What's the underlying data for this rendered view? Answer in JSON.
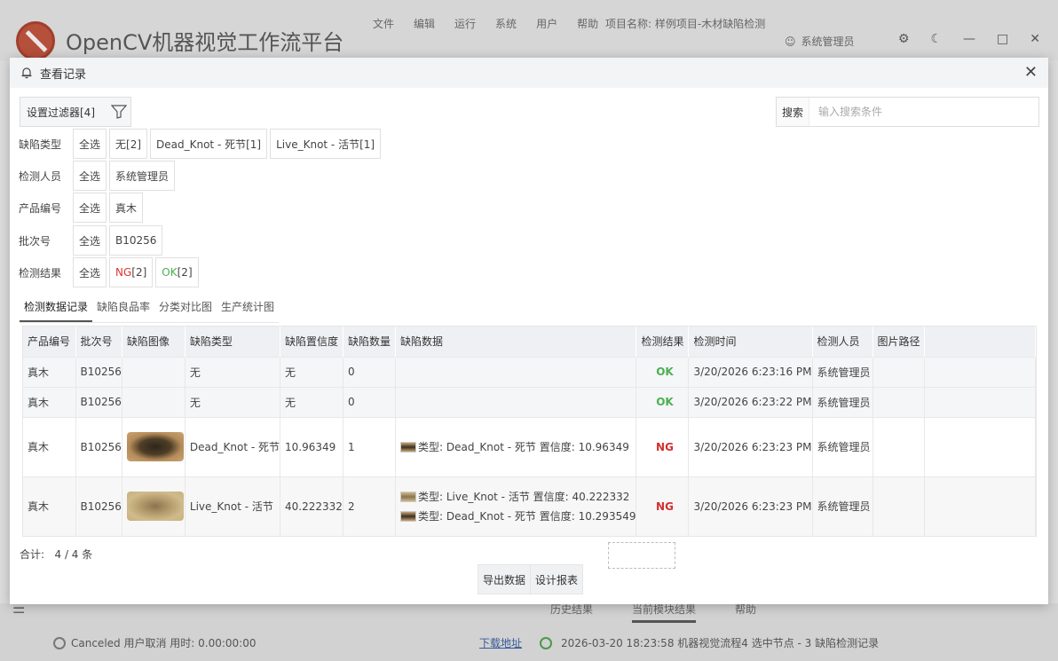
{
  "app": {
    "title": "OpenCV机器视觉工作流平台",
    "menu": [
      "文件",
      "编辑",
      "运行",
      "系统",
      "用户",
      "帮助"
    ],
    "project": "项目名称:  样例项目-木材缺陷检测",
    "user": "系统管理员",
    "bottom_tabs": [
      "历史结果",
      "当前模块结果",
      "帮助"
    ],
    "status_left": "Canceled 用户取消 用时: 0.00:00:00",
    "status_link": "下载地址",
    "status_right": "2026-03-20 18:23:58  机器视觉流程4 选中节点 - 3 缺陷检测记录"
  },
  "modal": {
    "title": "查看记录",
    "filter_button": "设置过滤器[4]",
    "search_label": "搜索",
    "search_placeholder": "输入搜索条件",
    "filters": [
      {
        "label": "缺陷类型",
        "chips": [
          "全选",
          "无[2]",
          "Dead_Knot - 死节[1]",
          "Live_Knot - 活节[1]"
        ]
      },
      {
        "label": "检测人员",
        "chips": [
          "全选",
          "系统管理员"
        ]
      },
      {
        "label": "产品编号",
        "chips": [
          "全选",
          "真木"
        ]
      },
      {
        "label": "批次号",
        "chips": [
          "全选",
          "B10256"
        ]
      },
      {
        "label": "检测结果",
        "chips": [
          "全选"
        ],
        "ng": "NG",
        "ng_count": "[2]",
        "ok": "OK",
        "ok_count": "[2]"
      }
    ],
    "tabs": [
      "检测数据记录",
      "缺陷良品率",
      "分类对比图",
      "生产统计图"
    ],
    "columns": [
      "产品编号",
      "批次号",
      "缺陷图像",
      "缺陷类型",
      "缺陷置信度",
      "缺陷数量",
      "缺陷数据",
      "检测结果",
      "检测时间",
      "检测人员",
      "图片路径"
    ],
    "rows": [
      {
        "product": "真木",
        "batch": "B10256",
        "type": "无",
        "confidence": "无",
        "count": "0",
        "result": "OK",
        "time": "3/20/2026 6:23:16 PM",
        "inspector": "系统管理员"
      },
      {
        "product": "真木",
        "batch": "B10256",
        "type": "无",
        "confidence": "无",
        "count": "0",
        "result": "OK",
        "time": "3/20/2026 6:23:22 PM",
        "inspector": "系统管理员"
      },
      {
        "product": "真木",
        "batch": "B10256",
        "type": "Dead_Knot - 死节",
        "confidence": "10.96349",
        "count": "1",
        "defect1": "类型: Dead_Knot - 死节    置信度: 10.96349",
        "result": "NG",
        "time": "3/20/2026 6:23:23 PM",
        "inspector": "系统管理员"
      },
      {
        "product": "真木",
        "batch": "B10256",
        "type": "Live_Knot - 活节",
        "confidence": "40.222332",
        "count": "2",
        "defect1": "类型: Live_Knot - 活节    置信度: 40.222332",
        "defect2": "类型: Dead_Knot - 死节    置信度: 10.293549",
        "result": "NG",
        "time": "3/20/2026 6:23:23 PM",
        "inspector": "系统管理员"
      }
    ],
    "total_label": "合计:",
    "total_value": "4 / 4 条",
    "export_button": "导出数据",
    "report_button": "设计报表"
  }
}
